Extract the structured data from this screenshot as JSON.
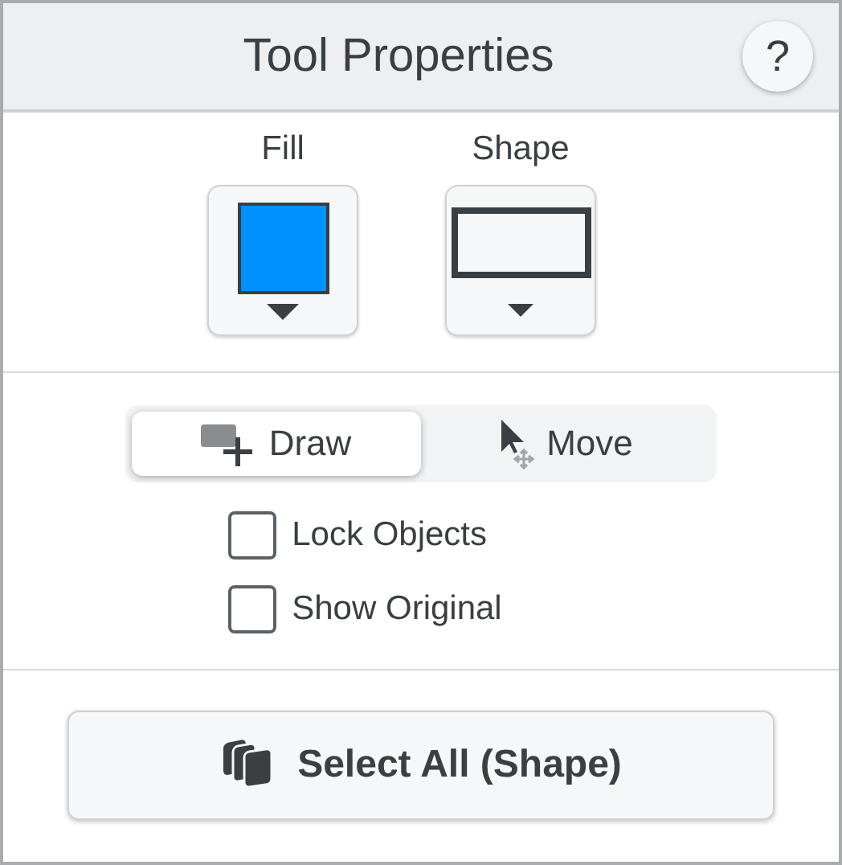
{
  "panel": {
    "title": "Tool Properties",
    "help": "?"
  },
  "pickers": [
    {
      "label": "Fill",
      "kind": "fill",
      "color": "#0091ff"
    },
    {
      "label": "Shape",
      "kind": "shape"
    }
  ],
  "modes": [
    {
      "label": "Draw",
      "kind": "draw",
      "selected": true
    },
    {
      "label": "Move",
      "kind": "move",
      "selected": false
    }
  ],
  "options": [
    {
      "label": "Lock Objects",
      "checked": false
    },
    {
      "label": "Show Original",
      "checked": false
    }
  ],
  "action": {
    "label": "Select All (Shape)"
  }
}
